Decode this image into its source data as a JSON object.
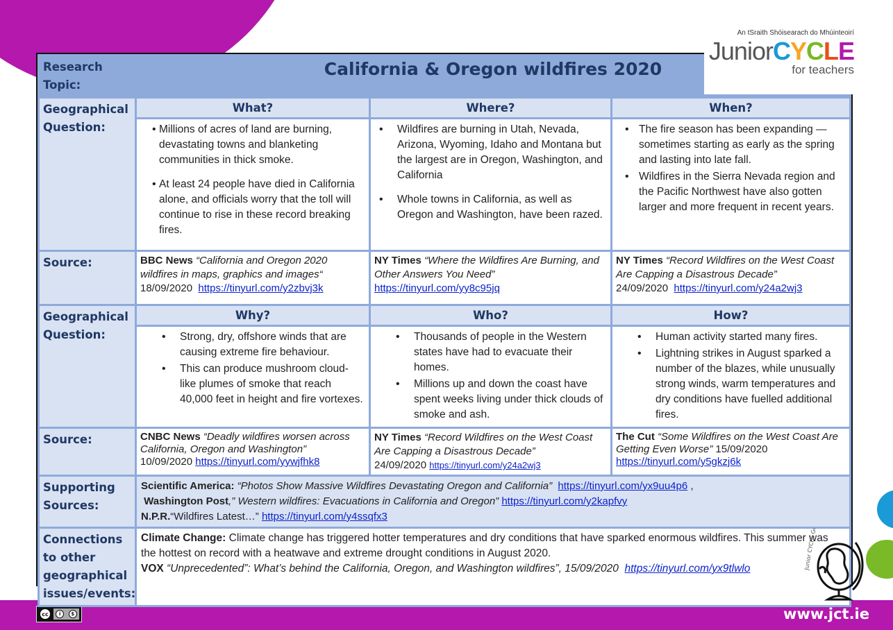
{
  "logo": {
    "subtitle": "An tSraith Shóisearach do Mhúinteoirí",
    "junior": "Junior",
    "cycle_letters": [
      {
        "char": "C",
        "color": "#1a9ad6"
      },
      {
        "char": "Y",
        "color": "#f5a623"
      },
      {
        "char": "C",
        "color": "#7ab928"
      },
      {
        "char": "L",
        "color": "#e94e1b"
      },
      {
        "char": "E",
        "color": "#b418ac"
      }
    ],
    "tagline": "for teachers"
  },
  "research_topic": {
    "label": "Research Topic:",
    "title": "California & Oregon wildfires 2020"
  },
  "question_blocks": [
    {
      "label": "Geographical Question:",
      "columns": [
        {
          "heading": "What?",
          "bullets": [
            "Millions of acres of land are burning, devastating towns and blanketing communities in thick smoke.",
            "At least 24 people have died in California alone, and officials worry that the toll will continue to rise in these record breaking fires."
          ]
        },
        {
          "heading": "Where?",
          "bullets": [
            "Wildfires are burning in Utah, Nevada, Arizona, Wyoming, Idaho and Montana but the largest are in Oregon, Washington, and California",
            "Whole towns in California, as well as Oregon and Washington, have been razed."
          ]
        },
        {
          "heading": "When?",
          "bullets": [
            "The fire season has been expanding — sometimes starting as early as the spring and lasting into late fall.",
            "Wildfires in the Sierra Nevada region and the Pacific Northwest have also gotten larger and more frequent in recent years."
          ]
        }
      ],
      "source_label": "Source:",
      "sources": [
        {
          "outlet": "BBC News",
          "title": "“California and Oregon 2020 wildfires in maps, graphics and images“",
          "date": "18/09/2020",
          "url": "https://tinyurl.com/y2zbvj3k"
        },
        {
          "outlet": "NY Times",
          "title": "“Where the Wildfires Are Burning, and Other Answers You Need”",
          "date": "",
          "url": "https://tinyurl.com/yy8c95jq"
        },
        {
          "outlet": "NY Times",
          "title": "“Record Wildfires on the West Coast Are Capping a Disastrous Decade”",
          "date": "24/09/2020",
          "url": "https://tinyurl.com/y24a2wj3"
        }
      ]
    },
    {
      "label": "Geographical Question:",
      "columns": [
        {
          "heading": "Why?",
          "bullets": [
            "Strong, dry, offshore winds that are causing extreme fire behaviour.",
            "This can produce mushroom cloud-like plumes of smoke that reach 40,000 feet in height and fire vortexes."
          ]
        },
        {
          "heading": "Who?",
          "bullets": [
            "Thousands of people in the Western states have had to evacuate their homes.",
            "Millions up and down the coast have spent weeks living under thick clouds of smoke and ash."
          ]
        },
        {
          "heading": "How?",
          "bullets": [
            "Human activity started many fires.",
            "Lightning strikes in August sparked a number of the blazes, while unusually strong winds, warm temperatures and dry conditions have fuelled additional fires."
          ]
        }
      ],
      "source_label": "Source:",
      "sources": [
        {
          "outlet": "CNBC News",
          "title": "“Deadly wildfires worsen across California, Oregon and Washington”",
          "date": "10/09/2020",
          "url": "https://tinyurl.com/yywjfhk8"
        },
        {
          "outlet": "NY Times",
          "title": "“Record Wildfires on the West Coast Are Capping a Disastrous Decade”",
          "date": "24/09/2020",
          "url": "https://tinyurl.com/y24a2wj3"
        },
        {
          "outlet": "The Cut",
          "title": "“Some Wildfires on the West Coast Are Getting Even Worse”",
          "date": "15/09/2020",
          "url": "https://tinyurl.com/y5gkzj6k"
        }
      ]
    }
  ],
  "supporting_sources": {
    "label": "Supporting Sources:",
    "items": [
      {
        "outlet": "Scientific America:",
        "title": "“Photos Show Massive Wildfires Devastating Oregon and California”",
        "url": "https://tinyurl.com/yx9uu4p6",
        "trailing": ","
      },
      {
        "outlet": "Washington Post",
        "title": ",” Western wildfires: Evacuations in California and Oregon”",
        "url": "https://tinyurl.com/y2kapfvy",
        "trailing": ""
      },
      {
        "outlet": "N.P.R.",
        "title": "“Wildfires Latest…”",
        "url": "https://tinyurl.com/y4ssqfx3",
        "trailing": ""
      }
    ]
  },
  "connections": {
    "label": "Connections to other geographical issues/events:",
    "climate_heading": "Climate Change:",
    "climate_text": "Climate change has triggered hotter temperatures and dry conditions that have sparked enormous wildfires.  This summer was the hottest on record with a heatwave and extreme drought conditions in August 2020.",
    "vox_outlet": "VOX",
    "vox_title": "“Unprecedented”: What’s behind the California, Oregon, and Washington wildfires”, 15/09/2020",
    "vox_url": "https://tinyurl.com/yx9tlwlo"
  },
  "badge": {
    "text": "Junior CYCLE Geography"
  },
  "footer": {
    "license_cc": "cc",
    "license_by": "BY",
    "license_nc": "NC",
    "site_url": "www.jct.ie"
  },
  "colors": {
    "brand_magenta": "#b418ac",
    "header_blue": "#8eaadb",
    "label_bg": "#d9e2f3",
    "label_text": "#1f3864",
    "link": "#0b22cc"
  }
}
